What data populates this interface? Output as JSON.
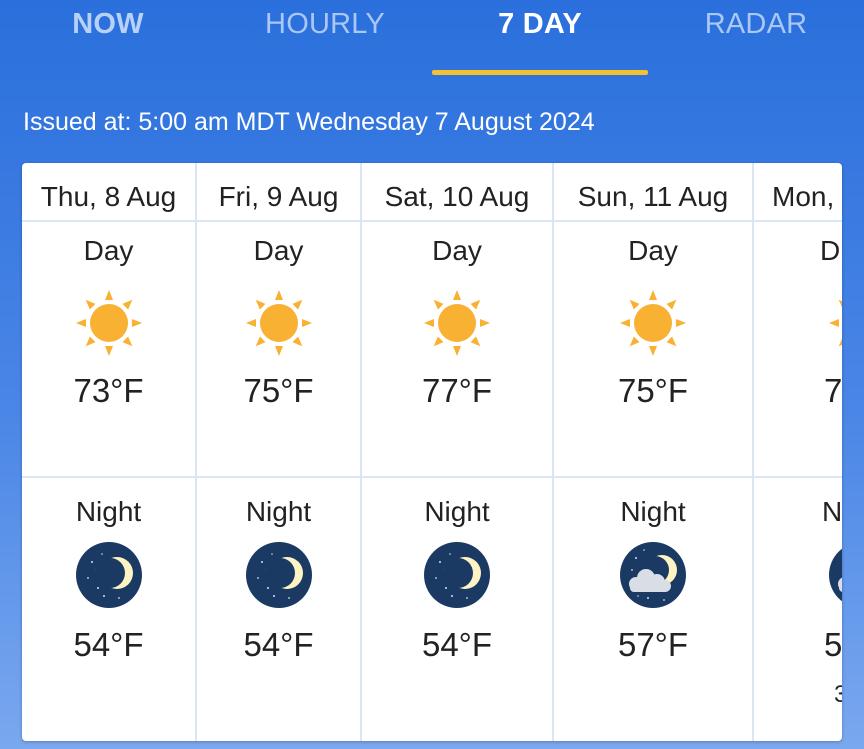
{
  "tabs": {
    "now": "NOW",
    "hourly": "HOURLY",
    "seven_day": "7 DAY",
    "radar": "RADAR",
    "active": "7 DAY"
  },
  "issued": "Issued at: 5:00 am MDT Wednesday 7 August 2024",
  "forecast": [
    {
      "date": "Thu, 8 Aug",
      "day_label": "Day",
      "day_icon": "sun-icon",
      "day_temp": "73°F",
      "night_label": "Night",
      "night_icon": "moon-icon",
      "night_temp": "54°F"
    },
    {
      "date": "Fri, 9 Aug",
      "day_label": "Day",
      "day_icon": "sun-icon",
      "day_temp": "75°F",
      "night_label": "Night",
      "night_icon": "moon-icon",
      "night_temp": "54°F"
    },
    {
      "date": "Sat, 10 Aug",
      "day_label": "Day",
      "day_icon": "sun-icon",
      "day_temp": "77°F",
      "night_label": "Night",
      "night_icon": "moon-icon",
      "night_temp": "54°F"
    },
    {
      "date": "Sun, 11 Aug",
      "day_label": "Day",
      "day_icon": "sun-icon",
      "day_temp": "75°F",
      "night_label": "Night",
      "night_icon": "moon-cloud-icon",
      "night_temp": "57°F"
    },
    {
      "date": "Mon,",
      "day_label": "D",
      "day_icon": "sun-icon",
      "day_temp": "7",
      "night_label": "N",
      "night_icon": "moon-cloud-icon",
      "night_temp": "5",
      "extra": "3"
    }
  ],
  "colors": {
    "header_bg": "#2a6fdc",
    "tab_indicator": "#f2c230",
    "sun": "#f8b133",
    "night_sky": "#1b3a63",
    "moon": "#fff3c4"
  }
}
